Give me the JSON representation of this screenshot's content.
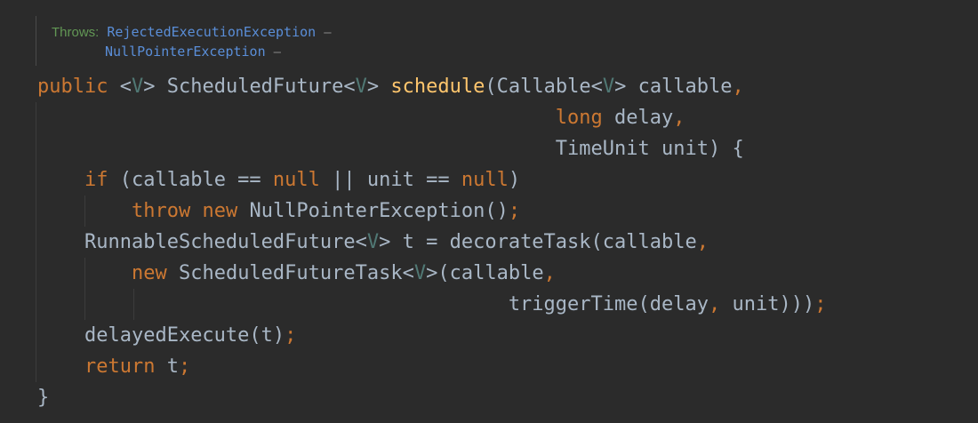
{
  "doc": {
    "throws_label": "Throws:",
    "exception1": "RejectedExecutionException",
    "exception2": "NullPointerException",
    "dash": "–"
  },
  "code": {
    "l1": {
      "kw_public": "public",
      "s1": " <",
      "g1": "V",
      "s2": "> ScheduledFuture<",
      "g2": "V",
      "s3": "> ",
      "fn": "schedule",
      "s4": "(Callable<",
      "g3": "V",
      "s5": "> callable",
      "comma": ","
    },
    "l2": {
      "pad": "                                            ",
      "kw_long": "long",
      "rest": " delay",
      "comma": ","
    },
    "l3": {
      "pad": "                                            ",
      "rest": "TimeUnit unit) {"
    },
    "l4": {
      "pad": "    ",
      "kw_if": "if",
      "s1": " (callable == ",
      "kw_null1": "null",
      "s2": " || unit == ",
      "kw_null2": "null",
      "s3": ")"
    },
    "l5": {
      "pad": "        ",
      "kw_throw": "throw",
      "sp": " ",
      "kw_new": "new",
      "rest": " NullPointerException()",
      "semi": ";"
    },
    "l6": {
      "pad": "    ",
      "s1": "RunnableScheduledFuture<",
      "g": "V",
      "s2": "> t = decorateTask(callable",
      "comma": ","
    },
    "l7": {
      "pad": "        ",
      "kw_new": "new",
      "s1": " ScheduledFutureTask<",
      "g": "V",
      "s2": ">(callable",
      "comma": ","
    },
    "l8": {
      "pad": "                                        ",
      "s1": "triggerTime(delay",
      "comma": ",",
      "s2": " unit)))",
      "semi": ";"
    },
    "l9": {
      "pad": "    ",
      "rest": "delayedExecute(t)",
      "semi": ";"
    },
    "l10": {
      "pad": "    ",
      "kw_return": "return",
      "rest": " t",
      "semi": ";"
    },
    "l11": {
      "rest": "}"
    }
  },
  "colors": {
    "background": "#2b2b2b",
    "keyword": "#cc7832",
    "method": "#ffc66d",
    "text": "#a9b7c6",
    "generic": "#507874",
    "doc_label": "#629755",
    "doc_link": "#5a8ed8"
  }
}
